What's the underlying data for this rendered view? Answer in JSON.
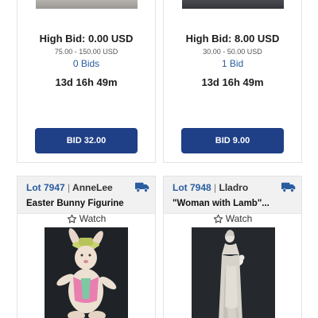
{
  "cards": [
    {
      "high_bid": "High Bid: 0.00 USD",
      "range": "75.00 - 150.00 USD",
      "bids": "0 Bids",
      "timer": "13d 16h 49m",
      "bid_button": "BID 32.00"
    },
    {
      "high_bid": "High Bid: 8.00 USD",
      "range": "30.00 - 50.00 USD",
      "bids": "1 Bid",
      "timer": "13d 16h 49m",
      "bid_button": "BID 9.00"
    }
  ],
  "lots": [
    {
      "lot": "Lot 7947",
      "separator": "|",
      "consignor": "AnneLee",
      "title": "Easter Bunny Figurine",
      "watch": "Watch",
      "icon": "truck-icon"
    },
    {
      "lot": "Lot 7948",
      "separator": "|",
      "consignor": "Lladro",
      "title": "\"Woman with Lamb\"...",
      "watch": "Watch",
      "icon": "truck-icon"
    }
  ],
  "colors": {
    "accent": "#1f3f86",
    "link": "#2a5d9f",
    "header_bg": "#f1f1f1"
  }
}
